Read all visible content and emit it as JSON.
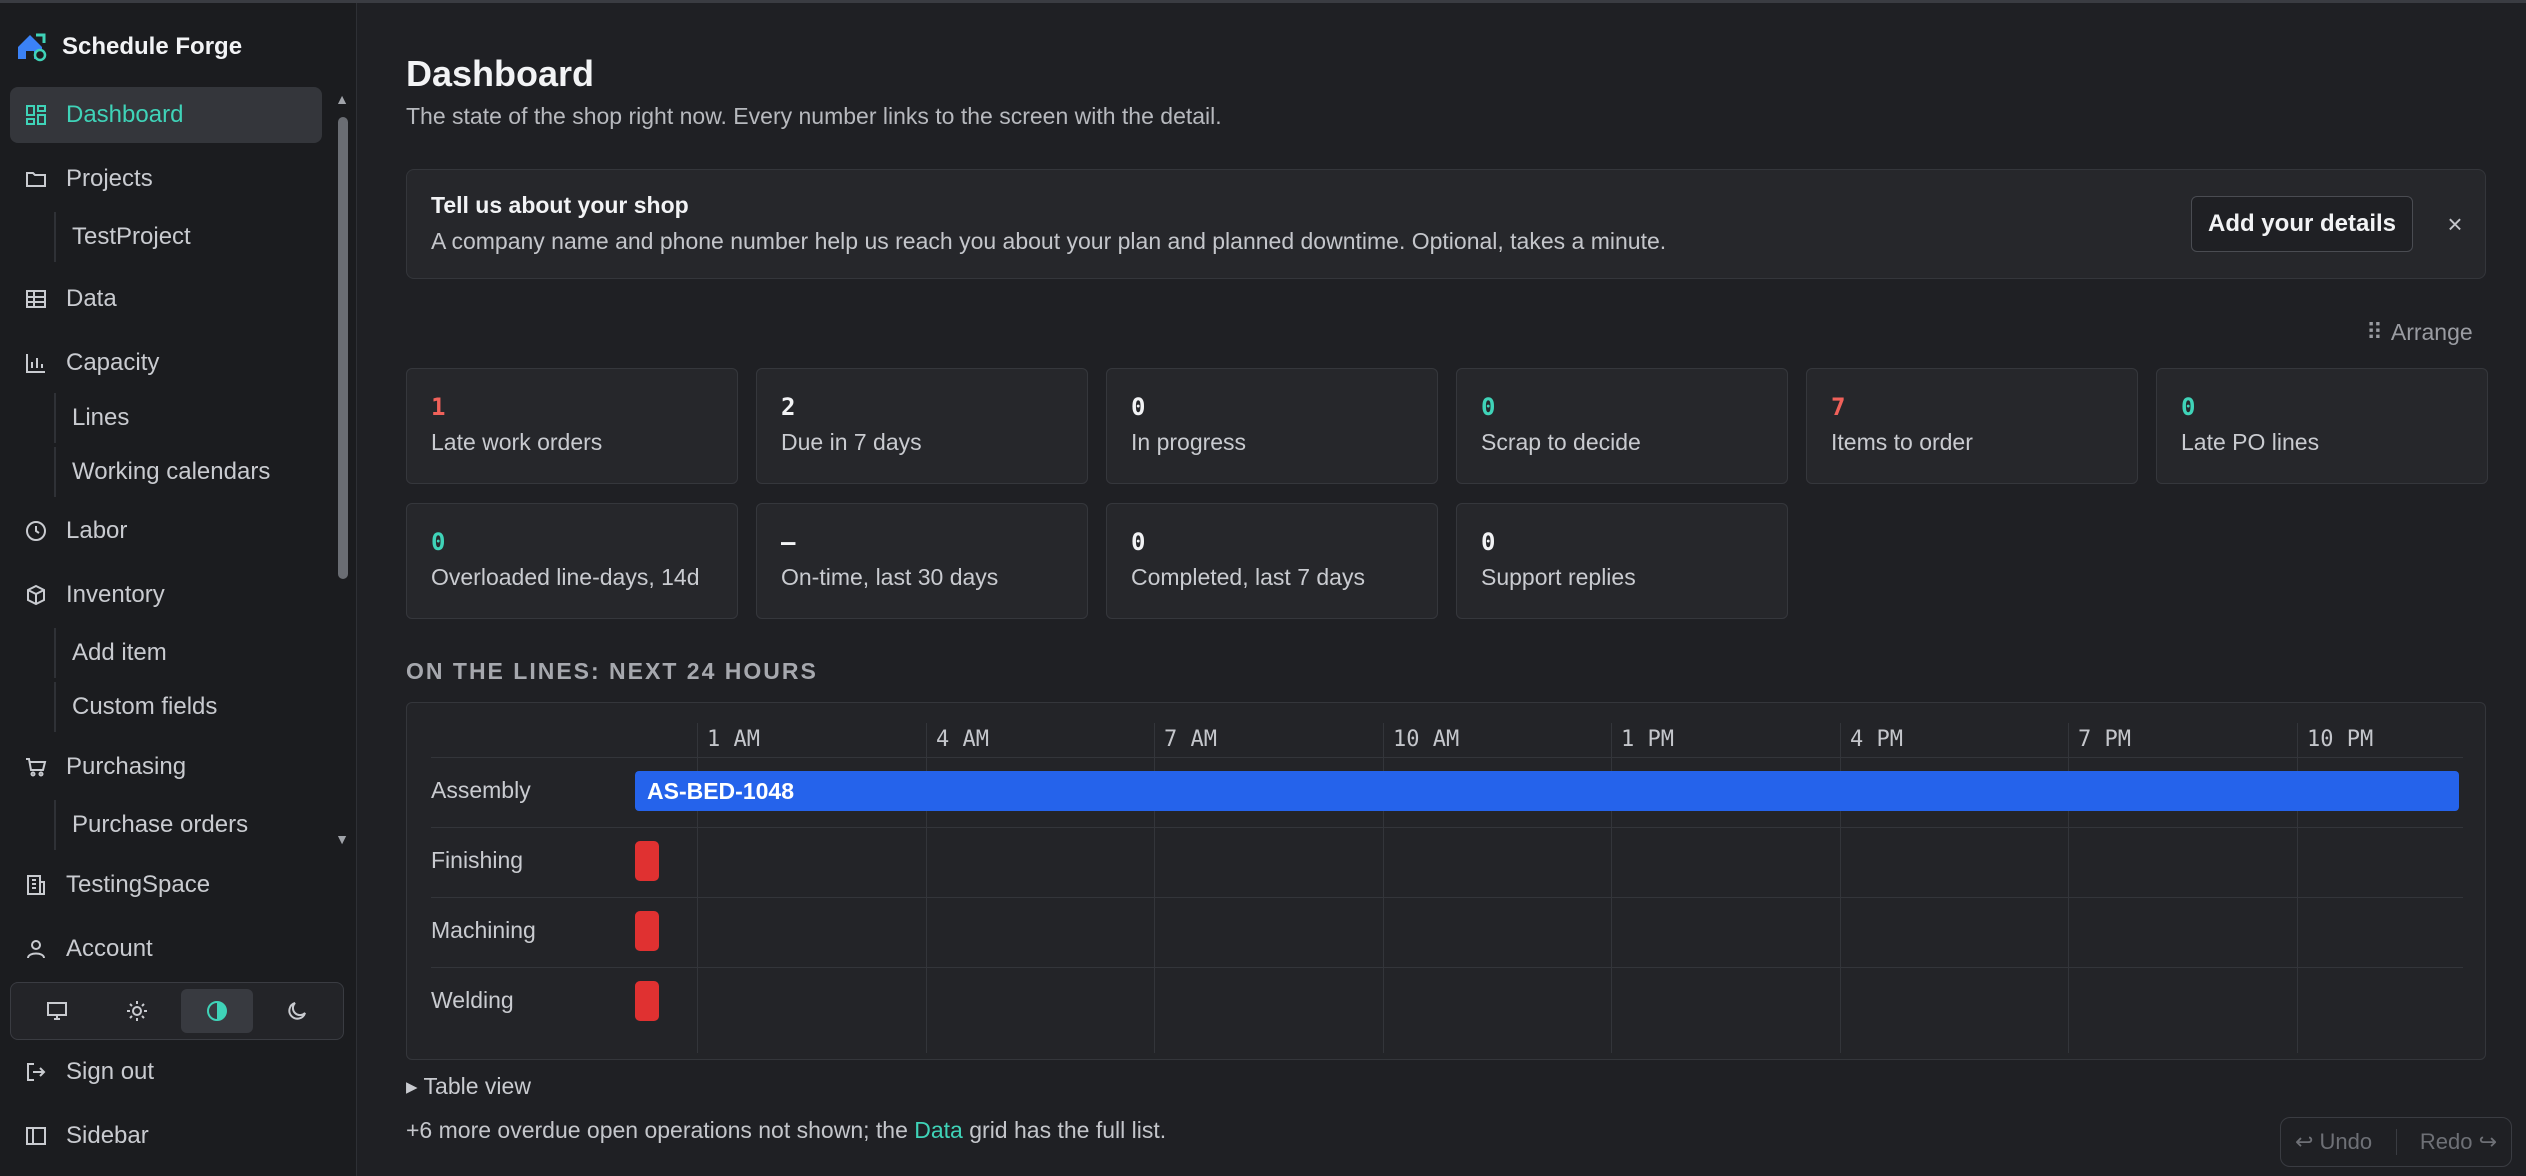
{
  "app": {
    "name": "Schedule Forge"
  },
  "sidebar": {
    "items": {
      "dashboard": "Dashboard",
      "projects": "Projects",
      "test_project": "TestProject",
      "data": "Data",
      "capacity": "Capacity",
      "lines": "Lines",
      "working_calendars": "Working calendars",
      "labor": "Labor",
      "inventory": "Inventory",
      "add_item": "Add item",
      "custom_fields": "Custom fields",
      "purchasing": "Purchasing",
      "purchase_orders": "Purchase orders",
      "testing_space": "TestingSpace",
      "account": "Account",
      "sign_out": "Sign out",
      "sidebar_toggle": "Sidebar"
    },
    "active": "dashboard",
    "theme_options": [
      "monitor-icon",
      "sun-icon",
      "contrast-icon",
      "moon-icon"
    ],
    "theme_active": "contrast-icon"
  },
  "page": {
    "title": "Dashboard",
    "subtitle": "The state of the shop right now. Every number links to the screen with the detail."
  },
  "banner": {
    "title": "Tell us about your shop",
    "text": "A company name and phone number help us reach you about your plan and planned downtime. Optional, takes a minute.",
    "button": "Add your details",
    "close": "×"
  },
  "arrange": {
    "icon": "⠿",
    "label": "Arrange"
  },
  "cards": [
    {
      "value": "1",
      "label": "Late work orders",
      "tone": "red"
    },
    {
      "value": "2",
      "label": "Due in 7 days",
      "tone": "white"
    },
    {
      "value": "0",
      "label": "In progress",
      "tone": "white"
    },
    {
      "value": "0",
      "label": "Scrap to decide",
      "tone": "teal"
    },
    {
      "value": "7",
      "label": "Items to order",
      "tone": "red"
    },
    {
      "value": "0",
      "label": "Late PO lines",
      "tone": "teal"
    },
    {
      "value": "0",
      "label": "Overloaded line-days, 14d",
      "tone": "teal"
    },
    {
      "value": "–",
      "label": "On-time, last 30 days",
      "tone": "white"
    },
    {
      "value": "0",
      "label": "Completed, last 7 days",
      "tone": "white"
    },
    {
      "value": "0",
      "label": "Support replies",
      "tone": "white"
    }
  ],
  "lines_section": {
    "title": "ON THE LINES: NEXT 24 HOURS",
    "ticks": [
      "1 AM",
      "4 AM",
      "7 AM",
      "10 AM",
      "1 PM",
      "4 PM",
      "7 PM",
      "10 PM"
    ],
    "rows": [
      "Assembly",
      "Finishing",
      "Machining",
      "Welding"
    ],
    "assembly_bar": "AS-BED-1048"
  },
  "table_view": {
    "arrow": "▸",
    "label": "Table view"
  },
  "footnote": {
    "before": "+6 more overdue open operations not shown; the ",
    "link": "Data",
    "after": " grid has the full list."
  },
  "history": {
    "undo": "Undo",
    "redo": "Redo"
  },
  "colors": {
    "accent": "#3fd3b8",
    "danger": "#e03131",
    "bar": "#2563eb",
    "background": "#1f2024"
  }
}
